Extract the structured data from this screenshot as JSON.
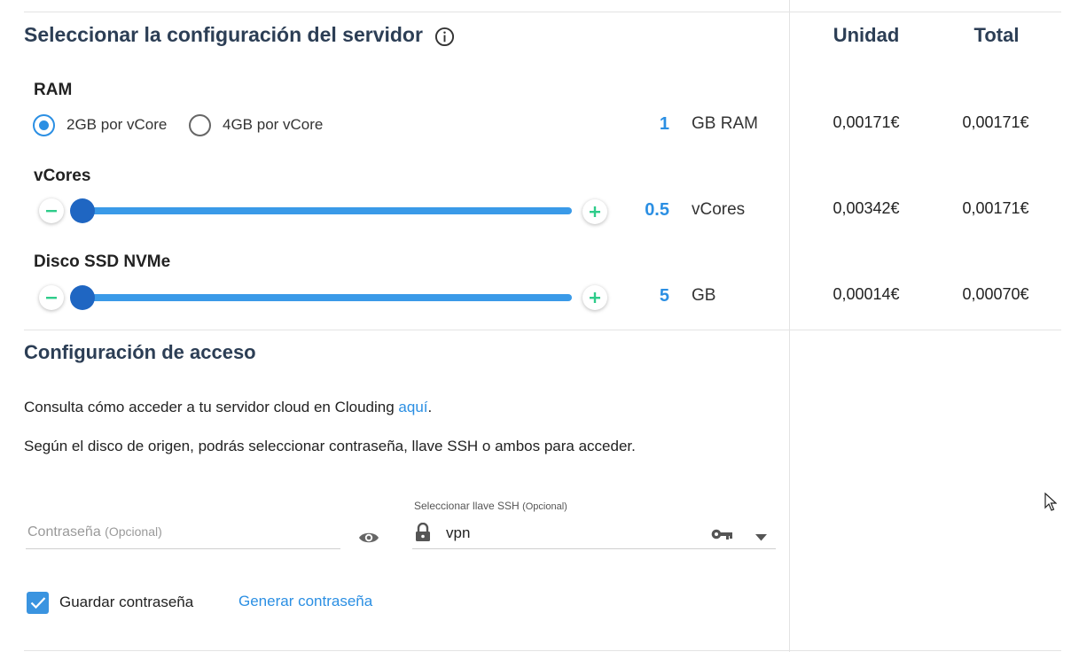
{
  "server_config": {
    "title": "Seleccionar la configuración del servidor",
    "col_unit": "Unidad",
    "col_total": "Total",
    "ram": {
      "label": "RAM",
      "options": [
        "2GB por vCore",
        "4GB por vCore"
      ],
      "selected": "2GB por vCore",
      "qty": "1",
      "unit": "GB RAM",
      "price_unit": "0,00171€",
      "price_total": "0,00171€"
    },
    "vcores": {
      "label": "vCores",
      "qty": "0.5",
      "unit": "vCores",
      "slider_level": 0,
      "price_unit": "0,00342€",
      "price_total": "0,00171€"
    },
    "disk": {
      "label": "Disco SSD NVMe",
      "qty": "5",
      "unit": "GB",
      "slider_level": 0,
      "price_unit": "0,00014€",
      "price_total": "0,00070€"
    }
  },
  "access": {
    "title": "Configuración de acceso",
    "info_prefix": "Consulta cómo acceder a tu servidor cloud en Clouding",
    "info_link": "aquí",
    "info_suffix": ".",
    "note": "Según el disco de origen, podrás seleccionar contraseña, llave SSH o ambos para acceder.",
    "password": {
      "placeholder": "Contraseña",
      "optional": "(Opcional)"
    },
    "ssh": {
      "label": "Seleccionar llave SSH",
      "optional": "(Opcional)",
      "value": "vpn"
    },
    "save_password_label": "Guardar contraseña",
    "save_password_checked": true,
    "generate_password_label": "Generar contraseña"
  },
  "colors": {
    "accent": "#2b8fe3",
    "heading": "#2c3e55",
    "slider_thumb": "#1f66c2",
    "plus_minus_green": "#2ecc8a"
  },
  "icons": [
    "info-icon",
    "minus-icon",
    "plus-icon",
    "eye-icon",
    "lock-icon",
    "key-icon",
    "caret-down-icon",
    "check-icon",
    "mouse-cursor-icon"
  ]
}
